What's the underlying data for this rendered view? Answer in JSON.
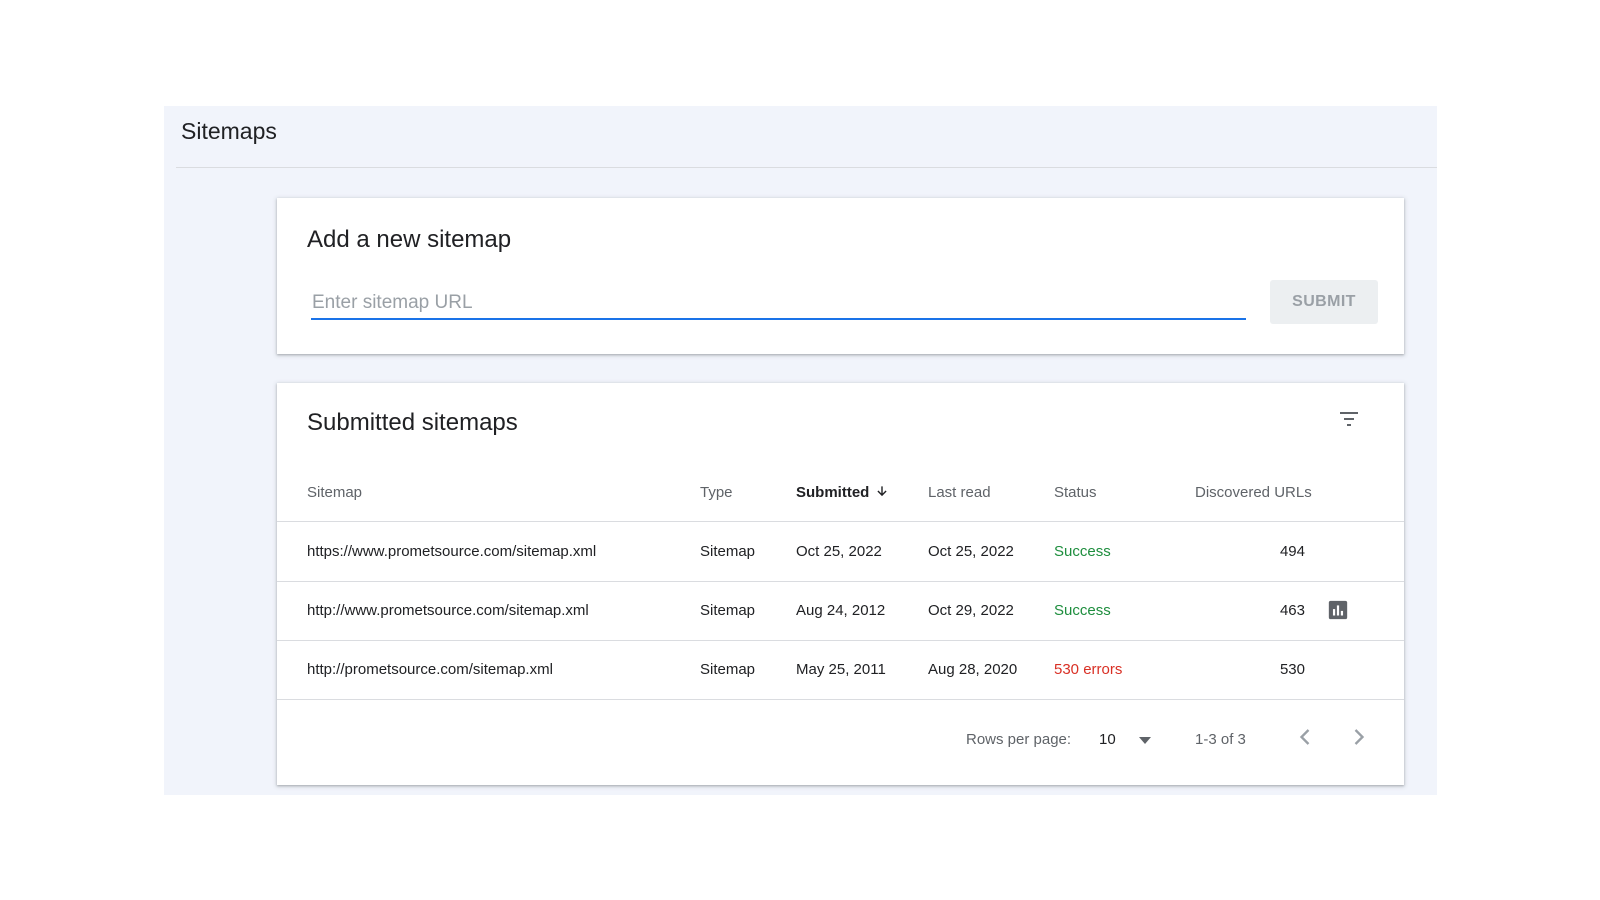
{
  "page": {
    "title": "Sitemaps"
  },
  "add_sitemap": {
    "title": "Add a new sitemap",
    "input_placeholder": "Enter sitemap URL",
    "input_value": "",
    "submit_label": "SUBMIT"
  },
  "submitted": {
    "title": "Submitted sitemaps",
    "columns": {
      "sitemap": "Sitemap",
      "type": "Type",
      "submitted": "Submitted",
      "last_read": "Last read",
      "status": "Status",
      "discovered_urls": "Discovered URLs"
    },
    "sort": {
      "column": "submitted",
      "direction": "descending"
    },
    "rows": [
      {
        "sitemap": "https://www.prometsource.com/sitemap.xml",
        "type": "Sitemap",
        "submitted": "Oct 25, 2022",
        "last_read": "Oct 25, 2022",
        "status": "Success",
        "discovered_urls": "494"
      },
      {
        "sitemap": "http://www.prometsource.com/sitemap.xml",
        "type": "Sitemap",
        "submitted": "Aug 24, 2012",
        "last_read": "Oct 29, 2022",
        "status": "Success",
        "discovered_urls": "463"
      },
      {
        "sitemap": "http://prometsource.com/sitemap.xml",
        "type": "Sitemap",
        "submitted": "May 25, 2011",
        "last_read": "Aug 28, 2020",
        "status": "530 errors",
        "discovered_urls": "530"
      }
    ],
    "pagination": {
      "rows_per_page_label": "Rows per page:",
      "rows_per_page": "10",
      "range": "1-3 of 3"
    }
  },
  "icons": {
    "filter": "filter-icon",
    "sort": "arrow-down-icon",
    "row_action": "bar-chart-icon",
    "dropdown": "caret-down-icon",
    "prev": "chevron-left-icon",
    "next": "chevron-right-icon"
  },
  "colors": {
    "accent": "#1a73e8",
    "success": "#1e8e3e",
    "error": "#d93025",
    "page_background": "#f1f4fb"
  }
}
